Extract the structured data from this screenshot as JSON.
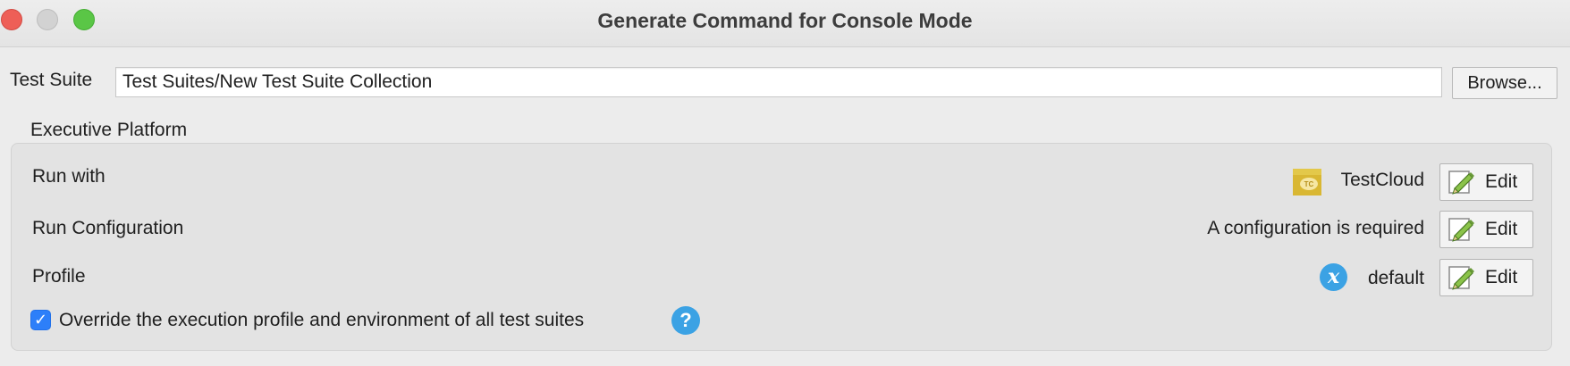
{
  "window": {
    "title": "Generate Command for Console Mode"
  },
  "test_suite": {
    "label": "Test Suite",
    "value": "Test Suites/New Test Suite Collection",
    "browse_label": "Browse..."
  },
  "executive_platform": {
    "title": "Executive Platform",
    "rows": [
      {
        "label": "Run with",
        "value": "TestCloud",
        "icon": "testcloud-icon",
        "edit_label": "Edit"
      },
      {
        "label": "Run Configuration",
        "value": "A configuration is required",
        "edit_label": "Edit"
      },
      {
        "label": "Profile",
        "value": "default",
        "icon": "variable-icon",
        "edit_label": "Edit"
      }
    ],
    "override": {
      "checked": true,
      "label": "Override the execution profile and environment of all test suites"
    }
  },
  "colors": {
    "accent": "#2d7ff9",
    "help_icon": "#3ba2e4",
    "close": "#ee5f57",
    "maximize": "#5ac646"
  }
}
